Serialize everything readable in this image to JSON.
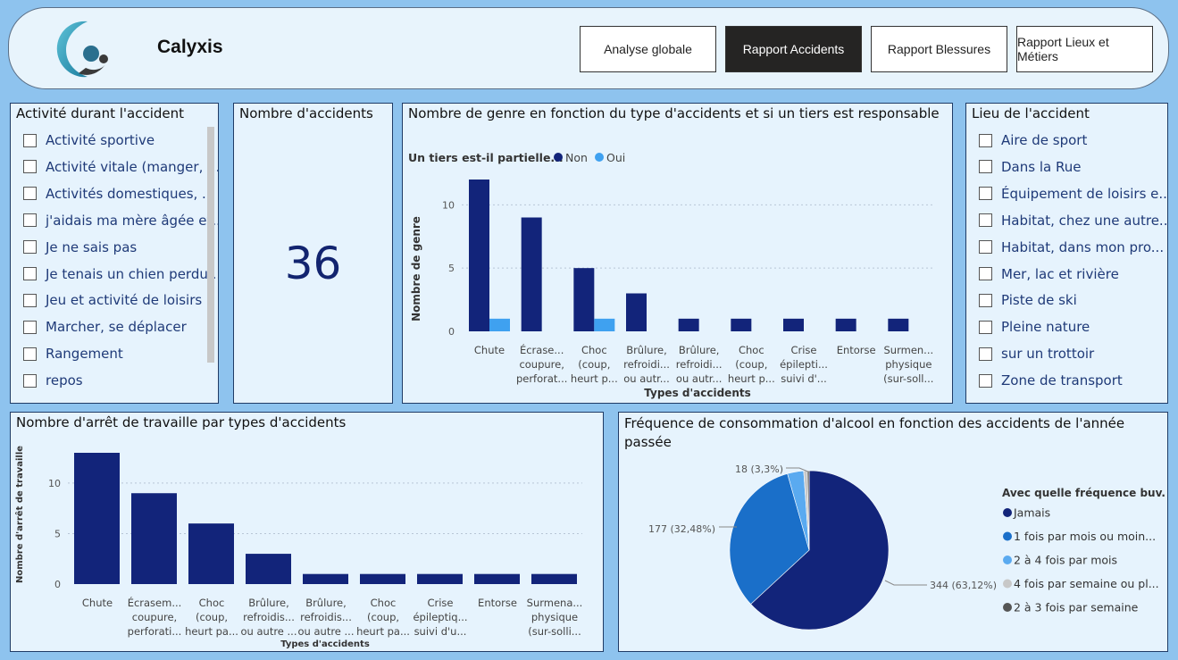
{
  "header": {
    "title": "Calyxis",
    "nav": [
      {
        "label": "Analyse globale",
        "active": false
      },
      {
        "label": "Rapport Accidents",
        "active": true
      },
      {
        "label": "Rapport Blessures",
        "active": false
      },
      {
        "label": "Rapport Lieux et Métiers",
        "active": false
      }
    ]
  },
  "activity_slicer": {
    "title": "Activité durant l'accident",
    "items": [
      "Activité sportive",
      "Activité vitale (manger, ...",
      "Activités domestiques, ...",
      "j'aidais ma mère âgée et...",
      "Je ne sais pas",
      "Je tenais un chien perdu...",
      "Jeu et activité de loisirs",
      "Marcher, se déplacer",
      "Rangement",
      "repos"
    ]
  },
  "kpi": {
    "title": "Nombre d'accidents",
    "value": "36"
  },
  "location_slicer": {
    "title": "Lieu de l'accident",
    "items": [
      "Aire de sport",
      "Dans la Rue",
      "Équipement de loisirs e...",
      "Habitat, chez une autre...",
      "Habitat, dans mon pro...",
      "Mer, lac et rivière",
      "Piste de ski",
      "Pleine nature",
      "sur un trottoir",
      "Zone de transport"
    ]
  },
  "colors": {
    "dark_blue": "#12247a",
    "light_blue": "#3fa1f0",
    "mid_blue": "#1a6fc9",
    "sky": "#5aaaf0",
    "grey": "#c8c8c8",
    "dark_grey": "#555555"
  },
  "chart_data": [
    {
      "type": "bar",
      "title": "Nombre de genre en fonction du type d'accidents et si un tiers est responsable",
      "legend_title": "Un tiers est-il partielle...",
      "legend_position": "top-left",
      "xlabel": "Types d'accidents",
      "ylabel": "Nombre de genre",
      "ylim": [
        0,
        12
      ],
      "yticks": [
        0,
        5,
        10
      ],
      "categories": [
        [
          "Chute"
        ],
        [
          "Écrase...",
          "coupure,",
          "perforat..."
        ],
        [
          "Choc",
          "(coup,",
          "heurt p..."
        ],
        [
          "Brûlure,",
          "refroidi...",
          "ou autr..."
        ],
        [
          "Brûlure,",
          "refroidi...",
          "ou autr..."
        ],
        [
          "Choc",
          "(coup,",
          "heurt p..."
        ],
        [
          "Crise",
          "épilepti...",
          "suivi d'..."
        ],
        [
          "Entorse"
        ],
        [
          "Surmen...",
          "physique",
          "(sur-soll..."
        ]
      ],
      "series": [
        {
          "name": "Non",
          "color": "#12247a",
          "values": [
            12,
            9,
            5,
            3,
            1,
            1,
            1,
            1,
            1
          ]
        },
        {
          "name": "Oui",
          "color": "#3fa1f0",
          "values": [
            1,
            0,
            1,
            0,
            0,
            0,
            0,
            0,
            0
          ]
        }
      ],
      "grid": true
    },
    {
      "type": "bar",
      "title": "Nombre d'arrêt de travaille par types d'accidents",
      "xlabel": "Types d'accidents",
      "ylabel": "Nombre d'arrêt de travaille",
      "ylim": [
        0,
        13
      ],
      "yticks": [
        0,
        5,
        10
      ],
      "categories": [
        [
          "Chute"
        ],
        [
          "Écrasem...",
          "coupure,",
          "perforati..."
        ],
        [
          "Choc",
          "(coup,",
          "heurt pa..."
        ],
        [
          "Brûlure,",
          "refroidis...",
          "ou autre ..."
        ],
        [
          "Brûlure,",
          "refroidis...",
          "ou autre ..."
        ],
        [
          "Choc",
          "(coup,",
          "heurt pa..."
        ],
        [
          "Crise",
          "épileptiq...",
          "suivi d'u..."
        ],
        [
          "Entorse"
        ],
        [
          "Surmena...",
          "physique",
          "(sur-solli..."
        ]
      ],
      "values": [
        13,
        9,
        6,
        3,
        1,
        1,
        1,
        1,
        1
      ],
      "color": "#12247a",
      "grid": true
    },
    {
      "type": "pie",
      "title": "Fréquence de consommation d'alcool en fonction des accidents de l'année passée",
      "legend_title": "Avec quelle fréquence buv...",
      "legend_position": "right",
      "slices": [
        {
          "label": "Jamais",
          "value": 344,
          "display": "344 (63,12%)",
          "color": "#12247a"
        },
        {
          "label": "1 fois par mois ou moin...",
          "value": 177,
          "display": "177 (32,48%)",
          "color": "#1a6fc9"
        },
        {
          "label": "2 à 4 fois par mois",
          "value": 18,
          "display": "18 (3,3%)",
          "color": "#5aaaf0"
        },
        {
          "label": "4 fois par semaine ou pl...",
          "value": 4,
          "display": "",
          "color": "#c8c8c8"
        },
        {
          "label": "2 à 3 fois par semaine",
          "value": 2,
          "display": "",
          "color": "#555555"
        }
      ]
    }
  ]
}
